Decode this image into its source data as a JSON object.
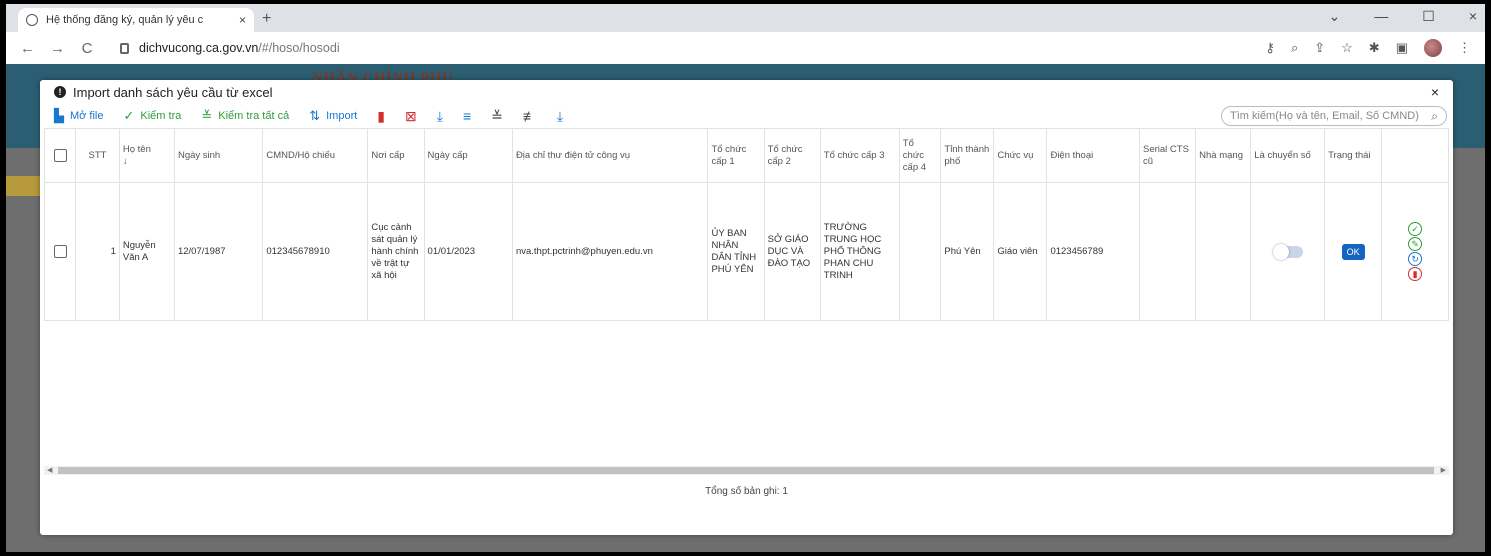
{
  "browser": {
    "tab_title": "Hệ thống đăng ký, quản lý yêu c",
    "tab_close": "×",
    "new_tab": "+",
    "url_host": "dichvucong.ca.gov.vn",
    "url_path": "/#/hoso/hosodi",
    "back": "←",
    "forward": "→",
    "reload": "C",
    "win_min": "—",
    "win_max": "☐",
    "win_close": "×",
    "win_chevron": "⌄"
  },
  "page": {
    "banner_text": "NHÂN CHÍNH PHỦ"
  },
  "modal": {
    "title": "Import danh sách yêu cầu từ excel",
    "close": "×",
    "toolbar": {
      "open_file": "Mở file",
      "check": "Kiểm tra",
      "check_all": "Kiểm tra tất cả",
      "import": "Import"
    },
    "search": {
      "placeholder": "Tìm kiếm(Họ và tên, Email, Số CMND)"
    },
    "table": {
      "headers": {
        "stt": "STT",
        "ho_ten": "Họ tên",
        "ngay_sinh": "Ngày sinh",
        "cmnd": "CMND/Hộ chiếu",
        "noi_cap": "Nơi cấp",
        "ngay_cap": "Ngày cấp",
        "email": "Địa chỉ thư điện tử công vụ",
        "tc1": "Tổ chức cấp 1",
        "tc2": "Tổ chức cấp 2",
        "tc3": "Tổ chức cấp 3",
        "tc4": "Tổ chức cấp 4",
        "tinh": "Tỉnh thành phố",
        "chuc_vu": "Chức vụ",
        "dien_thoai": "Điện thoại",
        "serial": "Serial CTS cũ",
        "nha_mang": "Nhà mạng",
        "la_chuyen_so": "Là chuyển số",
        "trang_thai": "Trạng thái",
        "sort_arrow": "↓"
      },
      "row": {
        "stt": "1",
        "ho_ten": "Nguyễn Văn A",
        "ngay_sinh": "12/07/1987",
        "cmnd": "012345678910",
        "noi_cap": "Cục cảnh sát quản lý hành chính về trật tự xã hội",
        "ngay_cap": "01/01/2023",
        "email": "nva.thpt.pctrinh@phuyen.edu.vn",
        "tc1": "ỦY BAN NHÂN DÂN TỈNH PHÚ YÊN",
        "tc2": "SỞ GIÁO DỤC VÀ ĐÀO TẠO",
        "tc3": "TRƯỜNG TRUNG HỌC PHỔ THÔNG PHAN CHU TRINH",
        "tc4": "",
        "tinh": "Phú Yên",
        "chuc_vu": "Giáo viên",
        "dien_thoai": "0123456789",
        "serial": "",
        "nha_mang": "",
        "la_chuyen_so": false,
        "trang_thai": "OK"
      }
    },
    "footer": "Tổng số bản ghi: 1"
  },
  "colors": {
    "primary": "#1976d2",
    "success": "#2e9e3a",
    "danger": "#d32f2f",
    "banner": "#2c5e73"
  }
}
